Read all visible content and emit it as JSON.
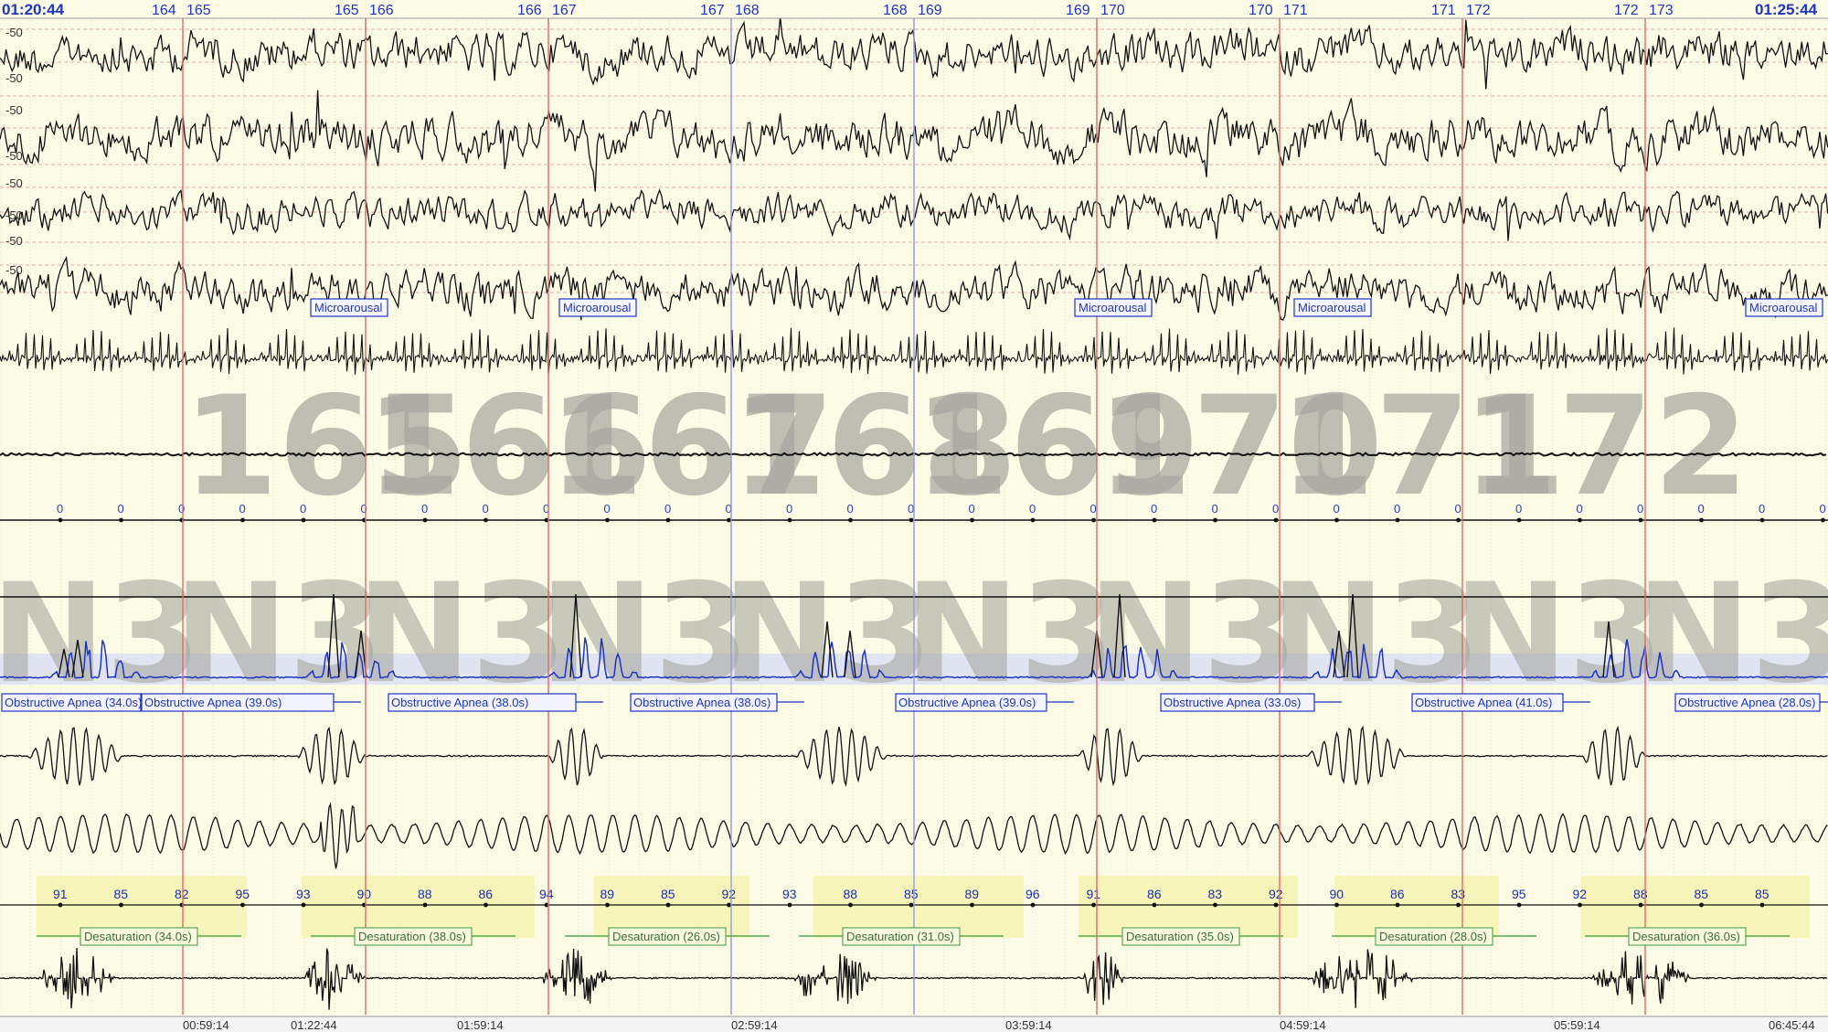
{
  "window": {
    "start_time": "01:20:44",
    "end_time": "01:25:44"
  },
  "epoch_markers": [
    [
      "164",
      "165"
    ],
    [
      "165",
      "166"
    ],
    [
      "166",
      "167"
    ],
    [
      "167",
      "168"
    ],
    [
      "168",
      "169"
    ],
    [
      "169",
      "170"
    ],
    [
      "170",
      "171"
    ],
    [
      "171",
      "172"
    ],
    [
      "172",
      "173"
    ]
  ],
  "big_epoch_numbers": [
    "165",
    "166",
    "167",
    "168",
    "169",
    "170",
    "171",
    "172"
  ],
  "sleep_stages": [
    "N3",
    "N3",
    "N3",
    "N3",
    "N3",
    "N3",
    "N3",
    "N3",
    "N3",
    "N3"
  ],
  "eeg_scale_labels": [
    "-50",
    "-50",
    "-50",
    "-50",
    "-50",
    "-50",
    "-50",
    "-50"
  ],
  "annotations": {
    "microarousal": [
      "Microarousal",
      "Microarousal",
      "Microarousal",
      "Microarousal",
      "Microarousal"
    ],
    "obstructive_apnea": [
      "Obstructive Apnea (34.0s)",
      "Obstructive Apnea (39.0s)",
      "Obstructive Apnea (38.0s)",
      "Obstructive Apnea (38.0s)",
      "Obstructive Apnea (39.0s)",
      "Obstructive Apnea (33.0s)",
      "Obstructive Apnea (41.0s)",
      "Obstructive Apnea (28.0s)"
    ],
    "desaturation": [
      "Desaturation (34.0s)",
      "Desaturation (38.0s)",
      "Desaturation (26.0s)",
      "Desaturation (31.0s)",
      "Desaturation (35.0s)",
      "Desaturation (28.0s)",
      "Desaturation (36.0s)"
    ]
  },
  "zero_values": [
    "0",
    "0",
    "0",
    "0",
    "0",
    "0",
    "0",
    "0",
    "0",
    "0",
    "0",
    "0",
    "0",
    "0",
    "0",
    "0",
    "0",
    "0",
    "0",
    "0",
    "0",
    "0",
    "0",
    "0",
    "0",
    "0",
    "0",
    "0",
    "0",
    "0"
  ],
  "spo2_values": [
    "91",
    "85",
    "82",
    "95",
    "93",
    "90",
    "88",
    "86",
    "94",
    "89",
    "85",
    "92",
    "93",
    "88",
    "85",
    "89",
    "96",
    "91",
    "86",
    "83",
    "92",
    "90",
    "86",
    "83",
    "95",
    "92",
    "88",
    "85",
    "85"
  ],
  "bottom_axis": [
    "00:59:14",
    "01:22:44",
    "01:59:14",
    "02:59:14",
    "03:59:14",
    "04:59:14",
    "05:59:14",
    "06:45:44"
  ],
  "colors": {
    "background": "#fbfbe6",
    "trace": "#111111",
    "label_blue": "#1f34c4",
    "epoch_line": "#e06a6a",
    "epoch_line_purple": "#9a9ae6",
    "grid_dash": "#e7a9a9",
    "desat_fill": "#f6f3b0",
    "desat_border": "#5aa85a",
    "apnea_band": "#d8dcf4"
  }
}
